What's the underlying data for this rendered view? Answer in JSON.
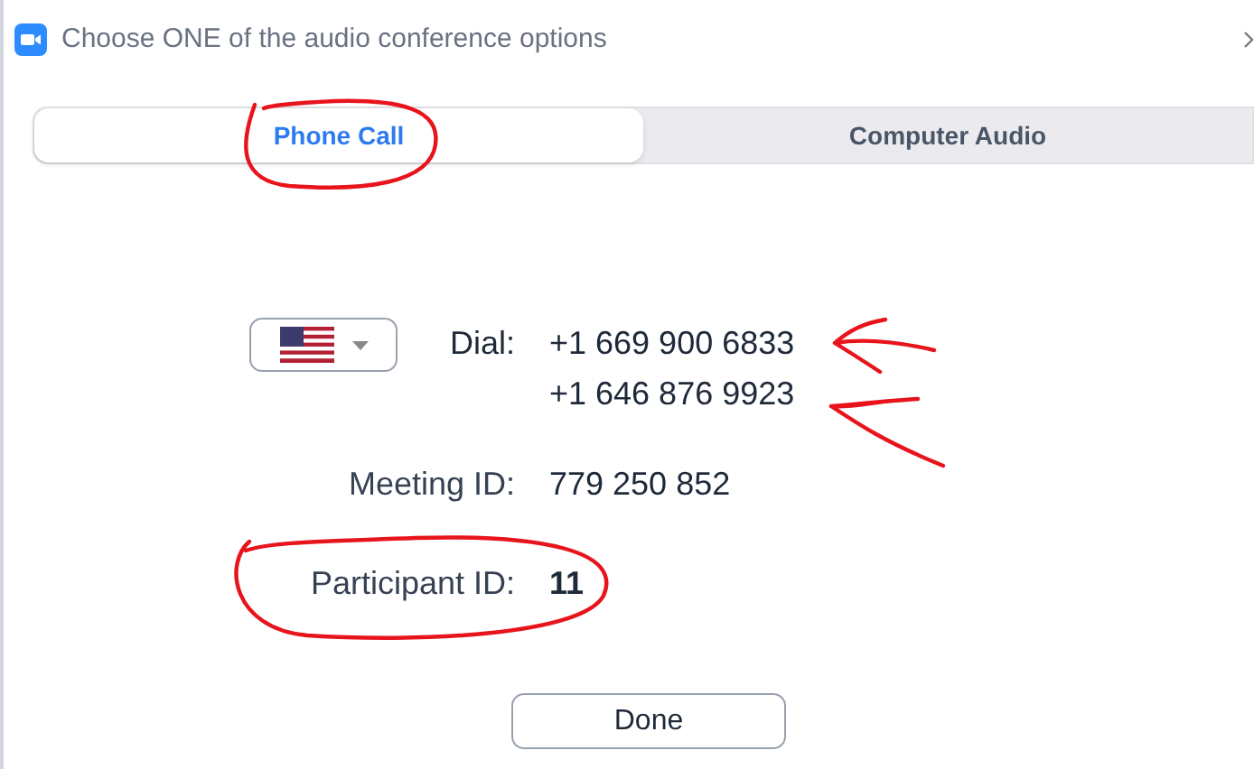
{
  "window": {
    "title": "Choose ONE of the audio conference options"
  },
  "tabs": [
    {
      "label": "Phone Call",
      "selected": true
    },
    {
      "label": "Computer Audio",
      "selected": false
    }
  ],
  "dial": {
    "label": "Dial:",
    "numbers": [
      "+1 669 900 6833",
      "+1 646 876 9923"
    ]
  },
  "fields": [
    {
      "label": "Meeting ID:",
      "value": "779 250 852",
      "bold": false
    },
    {
      "label": "Participant ID:",
      "value": "11",
      "bold": true
    }
  ],
  "buttons": [
    "Done"
  ]
}
